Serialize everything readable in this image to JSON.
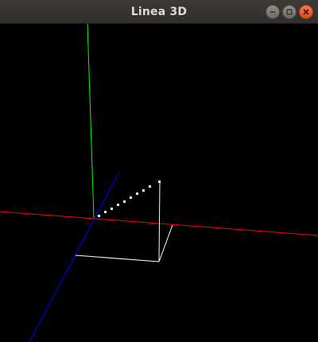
{
  "window": {
    "title": "Linea 3D",
    "controls": {
      "minimize": "minimize-icon",
      "maximize": "maximize-icon",
      "close": "close-icon"
    }
  },
  "scene": {
    "background": "#000000",
    "axes": {
      "x_color": "#ff0000",
      "y_color": "#00ff00",
      "z_color": "#0000ff"
    },
    "line_color": "#ffffff",
    "dot_color": "#ffffff"
  }
}
